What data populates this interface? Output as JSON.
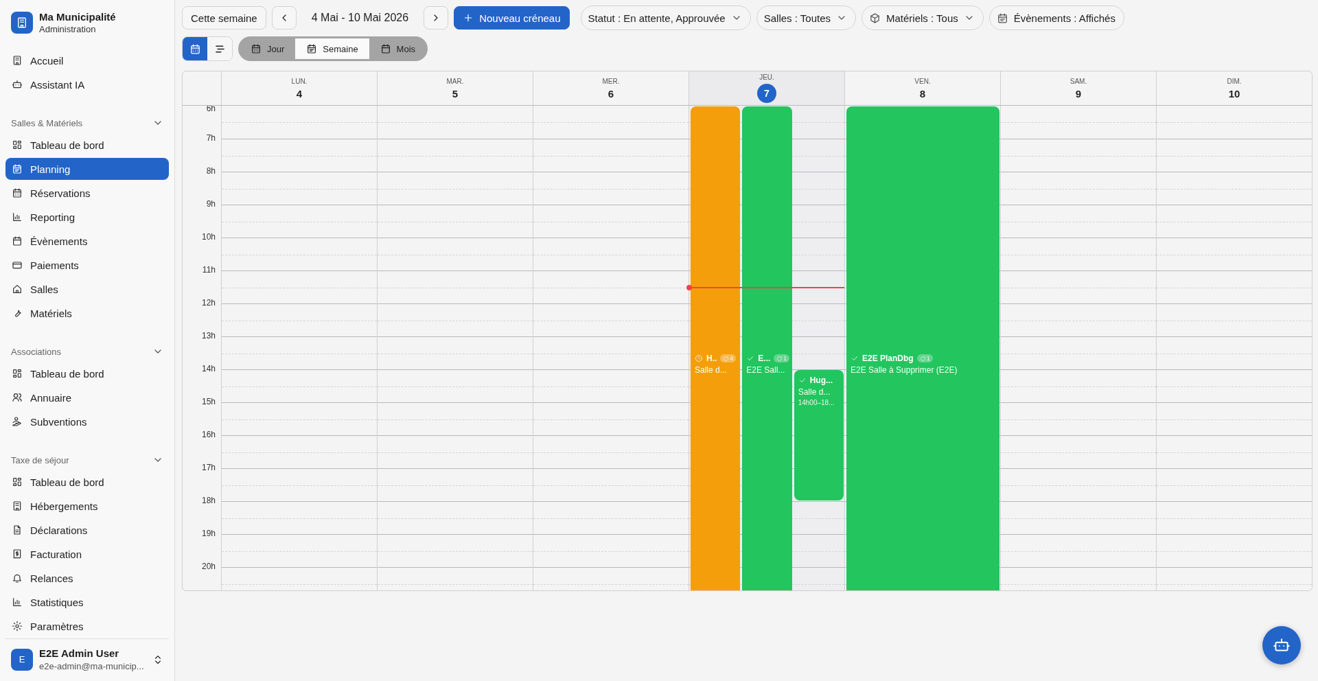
{
  "sidebar": {
    "org": {
      "name": "Ma Municipalité",
      "subtitle": "Administration"
    },
    "top_items": [
      {
        "label": "Accueil",
        "selected": false
      },
      {
        "label": "Assistant IA",
        "selected": false
      }
    ],
    "sections": [
      {
        "title": "Salles & Matériels",
        "expanded": true,
        "items": [
          {
            "label": "Tableau de bord",
            "selected": false
          },
          {
            "label": "Planning",
            "selected": true
          },
          {
            "label": "Réservations",
            "selected": false
          },
          {
            "label": "Reporting",
            "selected": false
          },
          {
            "label": "Évènements",
            "selected": false
          },
          {
            "label": "Paiements",
            "selected": false
          },
          {
            "label": "Salles",
            "selected": false
          },
          {
            "label": "Matériels",
            "selected": false
          }
        ]
      },
      {
        "title": "Associations",
        "expanded": true,
        "items": [
          {
            "label": "Tableau de bord",
            "selected": false
          },
          {
            "label": "Annuaire",
            "selected": false
          },
          {
            "label": "Subventions",
            "selected": false
          }
        ]
      },
      {
        "title": "Taxe de séjour",
        "expanded": true,
        "items": [
          {
            "label": "Tableau de bord",
            "selected": false
          },
          {
            "label": "Hébergements",
            "selected": false
          },
          {
            "label": "Déclarations",
            "selected": false
          },
          {
            "label": "Facturation",
            "selected": false
          },
          {
            "label": "Relances",
            "selected": false
          },
          {
            "label": "Statistiques",
            "selected": false
          },
          {
            "label": "Paramètres",
            "selected": false
          }
        ]
      }
    ],
    "user": {
      "initial": "E",
      "name": "E2E Admin User",
      "email": "e2e-admin@ma-municip..."
    }
  },
  "toolbar": {
    "today_button": "Cette semaine",
    "range": "4 Mai - 10 Mai 2026",
    "new_button": "Nouveau créneau",
    "filters": [
      {
        "label": "Statut : En attente, Approuvée",
        "dropdown": true
      },
      {
        "label": "Salles : Toutes",
        "dropdown": true
      },
      {
        "label": "Matériels : Tous",
        "dropdown": true
      },
      {
        "label": "Évènements : Affichés",
        "dropdown": false
      }
    ],
    "display_modes": [
      {
        "selected": true
      },
      {
        "selected": false
      }
    ],
    "views": [
      {
        "label": "Jour",
        "selected": false
      },
      {
        "label": "Semaine",
        "selected": true
      },
      {
        "label": "Mois",
        "selected": false
      }
    ]
  },
  "calendar": {
    "hours": [
      "6h",
      "7h",
      "8h",
      "9h",
      "10h",
      "11h",
      "12h",
      "13h",
      "14h",
      "15h",
      "16h",
      "17h",
      "18h",
      "19h",
      "20h"
    ],
    "days": [
      {
        "name": "LUN.",
        "number": "4",
        "today": false
      },
      {
        "name": "MAR.",
        "number": "5",
        "today": false
      },
      {
        "name": "MER.",
        "number": "6",
        "today": false
      },
      {
        "name": "JEU.",
        "number": "7",
        "today": true,
        "events": [
          {
            "kind": "pending",
            "title": "H..",
            "count": "4",
            "room": "Salle d..."
          },
          {
            "kind": "approved",
            "title": "E...",
            "count": "1",
            "room": "E2E Sall..."
          },
          {
            "kind": "approved",
            "title": "Hug...",
            "room": "Salle d...",
            "time": "14h00–18..."
          }
        ]
      },
      {
        "name": "VEN.",
        "number": "8",
        "today": false,
        "events": [
          {
            "kind": "approved",
            "title": "E2E PlanDbg",
            "count": "1",
            "room": "E2E Salle à Supprimer (E2E)"
          }
        ]
      },
      {
        "name": "SAM.",
        "number": "9",
        "today": false
      },
      {
        "name": "DIM.",
        "number": "10",
        "today": false
      }
    ]
  }
}
